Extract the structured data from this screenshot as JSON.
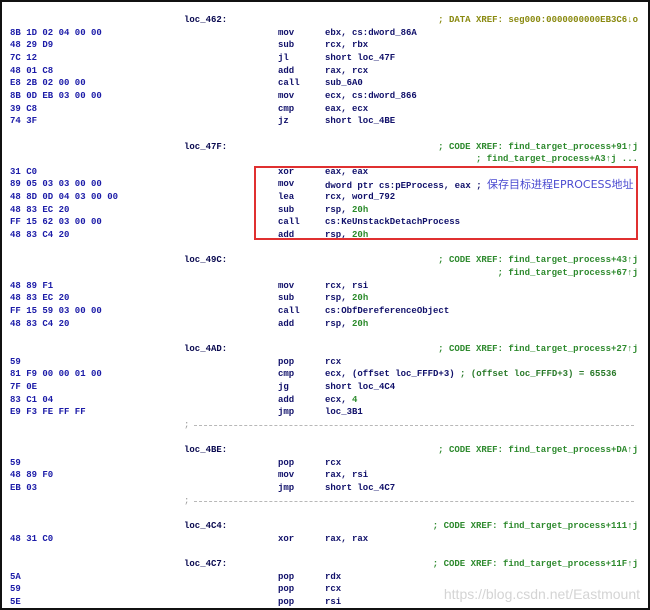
{
  "lines": [
    {
      "label": "loc_462:",
      "xref": "; DATA XREF: seg000:0000000000EB3C6↓o",
      "xref_kind": "data"
    },
    {
      "bytes": "8B 1D 02 04 00 00",
      "mnem": "mov",
      "op": "ebx, cs:dword_86A"
    },
    {
      "bytes": "48 29 D9",
      "mnem": "sub",
      "op": "rcx, rbx"
    },
    {
      "bytes": "7C 12",
      "mnem": "jl",
      "op": "short loc_47F"
    },
    {
      "bytes": "48 01 C8",
      "mnem": "add",
      "op": "rax, rcx"
    },
    {
      "bytes": "E8 2B 02 00 00",
      "mnem": "call",
      "op": "sub_6A0"
    },
    {
      "bytes": "8B 0D EB 03 00 00",
      "mnem": "mov",
      "op": "ecx, cs:dword_866"
    },
    {
      "bytes": "39 C8",
      "mnem": "cmp",
      "op": "eax, ecx"
    },
    {
      "bytes": "74 3F",
      "mnem": "jz",
      "op": "short loc_4BE"
    },
    {
      "blank": true
    },
    {
      "label": "loc_47F:",
      "xref": "; CODE XREF: find_target_process+91↑j"
    },
    {
      "xref": "; find_target_process+A3↑j ..."
    },
    {
      "bytes": "31 C0",
      "mnem": "xor",
      "op": "eax, eax"
    },
    {
      "bytes": "89 05 03 03 00 00",
      "mnem": "mov",
      "op": "dword ptr cs:pEProcess, eax ; ",
      "cn": "保存目标进程EPROCESS地址"
    },
    {
      "bytes": "48 8D 0D 04 03 00 00",
      "mnem": "lea",
      "op": "rcx, word_792"
    },
    {
      "bytes": "48 83 EC 20",
      "mnem": "sub",
      "op": "rsp, ",
      "num": "20h"
    },
    {
      "bytes": "FF 15 62 03 00 00",
      "mnem": "call",
      "op": "cs:KeUnstackDetachProcess"
    },
    {
      "bytes": "48 83 C4 20",
      "mnem": "add",
      "op": "rsp, ",
      "num": "20h"
    },
    {
      "blank": true
    },
    {
      "label": "loc_49C:",
      "xref": "; CODE XREF: find_target_process+43↑j"
    },
    {
      "xref": "; find_target_process+67↑j"
    },
    {
      "bytes": "48 89 F1",
      "mnem": "mov",
      "op": "rcx, rsi"
    },
    {
      "bytes": "48 83 EC 20",
      "mnem": "sub",
      "op": "rsp, ",
      "num": "20h"
    },
    {
      "bytes": "FF 15 59 03 00 00",
      "mnem": "call",
      "op": "cs:ObfDereferenceObject"
    },
    {
      "bytes": "48 83 C4 20",
      "mnem": "add",
      "op": "rsp, ",
      "num": "20h"
    },
    {
      "blank": true
    },
    {
      "label": "loc_4AD:",
      "xref": "; CODE XREF: find_target_process+27↑j"
    },
    {
      "bytes": "59",
      "mnem": "pop",
      "op": "rcx"
    },
    {
      "bytes": "81 F9 00 00 01 00",
      "mnem": "cmp",
      "op": "ecx, (offset loc_FFFD+3) ",
      "icmt": "; (offset loc_FFFD+3) = 65536"
    },
    {
      "bytes": "7F 0E",
      "mnem": "jg",
      "op": "short loc_4C4"
    },
    {
      "bytes": "83 C1 04",
      "mnem": "add",
      "op": "ecx, ",
      "num": "4"
    },
    {
      "bytes": "E9 F3 FE FF FF",
      "mnem": "jmp",
      "op": "loc_3B1"
    },
    {
      "separator": ";"
    },
    {
      "blank": true
    },
    {
      "label": "loc_4BE:",
      "xref": "; CODE XREF: find_target_process+DA↑j"
    },
    {
      "bytes": "59",
      "mnem": "pop",
      "op": "rcx"
    },
    {
      "bytes": "48 89 F0",
      "mnem": "mov",
      "op": "rax, rsi"
    },
    {
      "bytes": "EB 03",
      "mnem": "jmp",
      "op": "short loc_4C7"
    },
    {
      "separator": ";"
    },
    {
      "blank": true
    },
    {
      "label": "loc_4C4:",
      "xref": "; CODE XREF: find_target_process+111↑j"
    },
    {
      "bytes": "48 31 C0",
      "mnem": "xor",
      "op": "rax, rax"
    },
    {
      "blank": true
    },
    {
      "label": "loc_4C7:",
      "xref": "; CODE XREF: find_target_process+11F↑j"
    },
    {
      "bytes": "5A",
      "mnem": "pop",
      "op": "rdx"
    },
    {
      "bytes": "59",
      "mnem": "pop",
      "op": "rcx"
    },
    {
      "bytes": "5E",
      "mnem": "pop",
      "op": "rsi"
    }
  ],
  "highlight_color": "#e03030",
  "watermark": "https://blog.csdn.net/Eastmount"
}
